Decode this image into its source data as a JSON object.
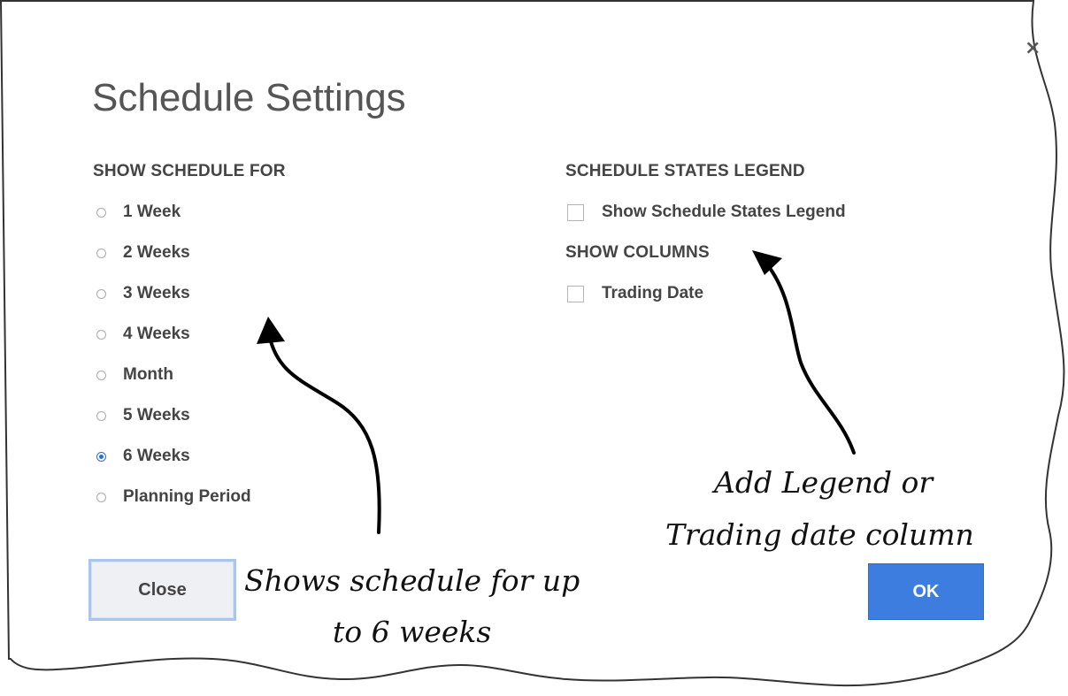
{
  "dialog": {
    "title": "Schedule Settings",
    "close_icon": "×"
  },
  "schedule_for": {
    "heading": "SHOW SCHEDULE FOR",
    "options": [
      {
        "label": "1 Week",
        "selected": false
      },
      {
        "label": "2 Weeks",
        "selected": false
      },
      {
        "label": "3 Weeks",
        "selected": false
      },
      {
        "label": "4 Weeks",
        "selected": false
      },
      {
        "label": "Month",
        "selected": false
      },
      {
        "label": "5 Weeks",
        "selected": false
      },
      {
        "label": "6 Weeks",
        "selected": true
      },
      {
        "label": "Planning Period",
        "selected": false
      }
    ]
  },
  "legend": {
    "heading": "SCHEDULE STATES LEGEND",
    "checkbox_label": "Show Schedule States Legend",
    "checked": false
  },
  "columns": {
    "heading": "SHOW COLUMNS",
    "checkbox_label": "Trading Date",
    "checked": false
  },
  "buttons": {
    "close_label": "Close",
    "ok_label": "OK"
  },
  "annotations": {
    "left_line1": "Shows schedule for up",
    "left_line2": "to 6 weeks",
    "right_line1": "Add Legend or",
    "right_line2": "Trading date column"
  },
  "colors": {
    "accent": "#3d7de0",
    "text": "#444444"
  }
}
